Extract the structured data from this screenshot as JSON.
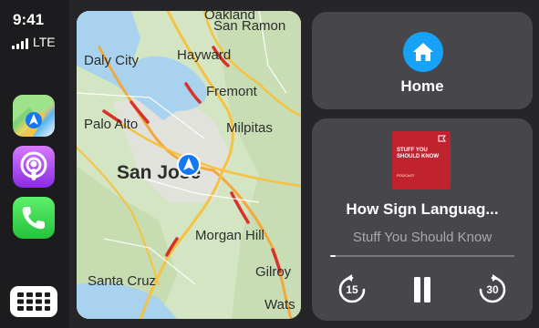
{
  "status": {
    "time": "9:41",
    "network": "LTE"
  },
  "sidebar": {
    "apps": [
      {
        "name": "Maps",
        "icon": "maps-icon"
      },
      {
        "name": "Podcasts",
        "icon": "podcasts-icon"
      },
      {
        "name": "Phone",
        "icon": "phone-icon"
      }
    ],
    "launcher_icon": "app-grid-icon"
  },
  "map": {
    "labels": {
      "oakland": "Oakland",
      "san_ramon": "San Ramon",
      "daly_city": "Daly City",
      "hayward": "Hayward",
      "fremont": "Fremont",
      "palo_alto": "Palo Alto",
      "milpitas": "Milpitas",
      "san_jose": "San José",
      "morgan_hill": "Morgan Hill",
      "santa_cruz": "Santa Cruz",
      "gilroy": "Gilroy",
      "watsonville": "Wats"
    },
    "location_icon": "navigation-arrow-icon"
  },
  "home": {
    "label": "Home",
    "icon": "house-icon",
    "accent": "#16a2f7"
  },
  "now_playing": {
    "title": "How Sign Languag...",
    "show": "Stuff You Should Know",
    "artwork_text": "STUFF YOU SHOULD KNOW",
    "artwork_sub": "PODCAST",
    "progress": 0.01,
    "skip_back": "15",
    "skip_forward": "30",
    "artwork_color": "#c0232e"
  }
}
